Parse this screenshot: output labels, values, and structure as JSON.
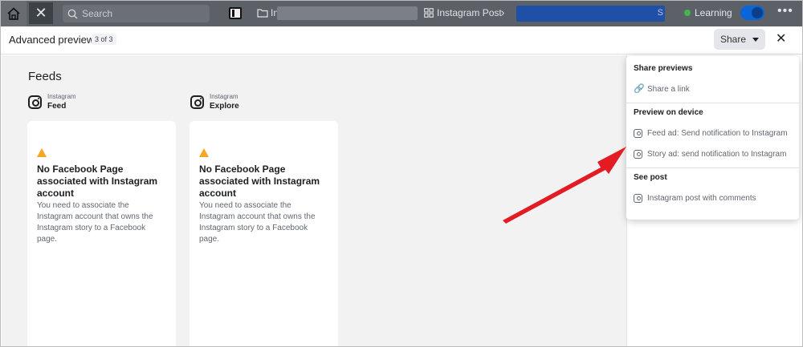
{
  "topbar": {
    "search_placeholder": "Search",
    "breadcrumb_folder": "In",
    "breadcrumb_post": "Instagram Post",
    "chevron": "›",
    "breadcrumb_tail": "S",
    "learning_label": "Learning",
    "more": "•••",
    "close": "✕"
  },
  "header": {
    "title": "Advanced preview",
    "count": "3 of 3",
    "share_label": "Share",
    "close": "✕"
  },
  "main": {
    "section_title": "Feeds",
    "placements": [
      {
        "platform": "Instagram",
        "name": "Feed",
        "warning_title": "No Facebook Page associated with Instagram account",
        "warning_body": "You need to associate the Instagram account that owns the Instagram story to a Facebook page."
      },
      {
        "platform": "Instagram",
        "name": "Explore",
        "warning_title": "No Facebook Page associated with Instagram account",
        "warning_body": "You need to associate the Instagram account that owns the Instagram story to a Facebook page."
      }
    ]
  },
  "dropdown": {
    "share_previews": "Share previews",
    "share_link": "Share a link",
    "preview_on_device": "Preview on device",
    "feed_ad": "Feed ad: Send notification to Instagram",
    "story_ad": "Story ad: send notification to Instagram",
    "see_post": "See post",
    "post_with_comments": "Instagram post with comments"
  },
  "colors": {
    "accent": "#0a66d8",
    "warning": "#f5a623",
    "annotation_arrow": "#e31b23",
    "learning_dot": "#44b549"
  }
}
